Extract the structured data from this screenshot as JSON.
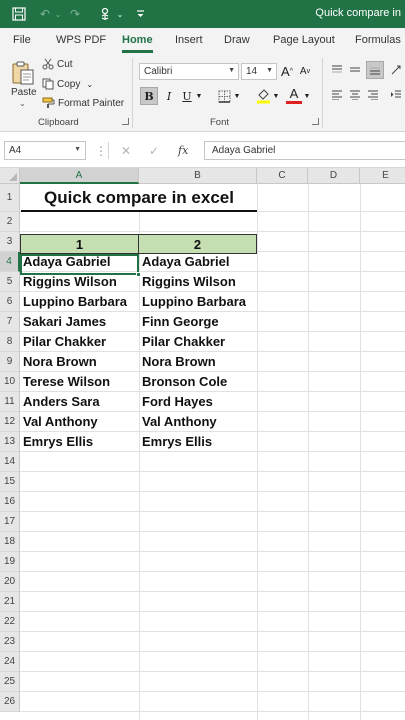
{
  "window": {
    "title": "Quick compare in"
  },
  "quick_access": {
    "save_icon": "save-icon",
    "undo_icon": "undo-icon",
    "redo_icon": "redo-icon",
    "touch_icon": "touch-mode-icon",
    "customize_icon": "customize-toolbar-icon"
  },
  "tabs": [
    {
      "label": "File"
    },
    {
      "label": "WPS PDF"
    },
    {
      "label": "Home"
    },
    {
      "label": "Insert"
    },
    {
      "label": "Draw"
    },
    {
      "label": "Page Layout"
    },
    {
      "label": "Formulas"
    }
  ],
  "ribbon": {
    "clipboard": {
      "paste_label": "Paste",
      "paste_caret": "⌄",
      "cut_label": "Cut",
      "copy_label": "Copy",
      "copy_caret": "⌄",
      "format_painter_label": "Format Painter",
      "group_label": "Clipboard"
    },
    "font": {
      "font_name": "Calibri",
      "font_size": "14",
      "grow_label": "A",
      "shrink_label": "A",
      "bold_label": "B",
      "italic_label": "I",
      "underline_label": "U",
      "font_color_label": "A",
      "group_label": "Font"
    }
  },
  "formula_bar": {
    "name_box": "A4",
    "cancel_symbol": "✕",
    "enter_symbol": "✓",
    "fx_label": "fx",
    "value": "Adaya Gabriel"
  },
  "grid": {
    "columns": [
      "A",
      "B",
      "C",
      "D",
      "E"
    ],
    "rows": [
      "1",
      "2",
      "3",
      "4",
      "5",
      "6",
      "7",
      "8",
      "9",
      "10",
      "11",
      "12",
      "13",
      "14",
      "15",
      "16",
      "17",
      "18",
      "19",
      "20",
      "21",
      "22",
      "23",
      "24",
      "25",
      "26"
    ],
    "title": "Quick compare in excel",
    "header_a": "1",
    "header_b": "2",
    "list_a": [
      "Adaya Gabriel",
      "Riggins Wilson",
      "Luppino Barbara",
      "Sakari James",
      "Pilar Chakker",
      "Nora Brown",
      "Terese Wilson",
      "Anders Sara",
      "Val Anthony",
      "Emrys Ellis"
    ],
    "list_b": [
      "Adaya Gabriel",
      "Riggins Wilson",
      "Luppino Barbara",
      "Finn George",
      "Pilar Chakker",
      "Nora Brown",
      "Bronson Cole",
      "Ford Hayes",
      "Val Anthony",
      "Emrys Ellis"
    ],
    "colors": {
      "header_fill": "#c6dfb2",
      "accent": "#217346"
    }
  }
}
